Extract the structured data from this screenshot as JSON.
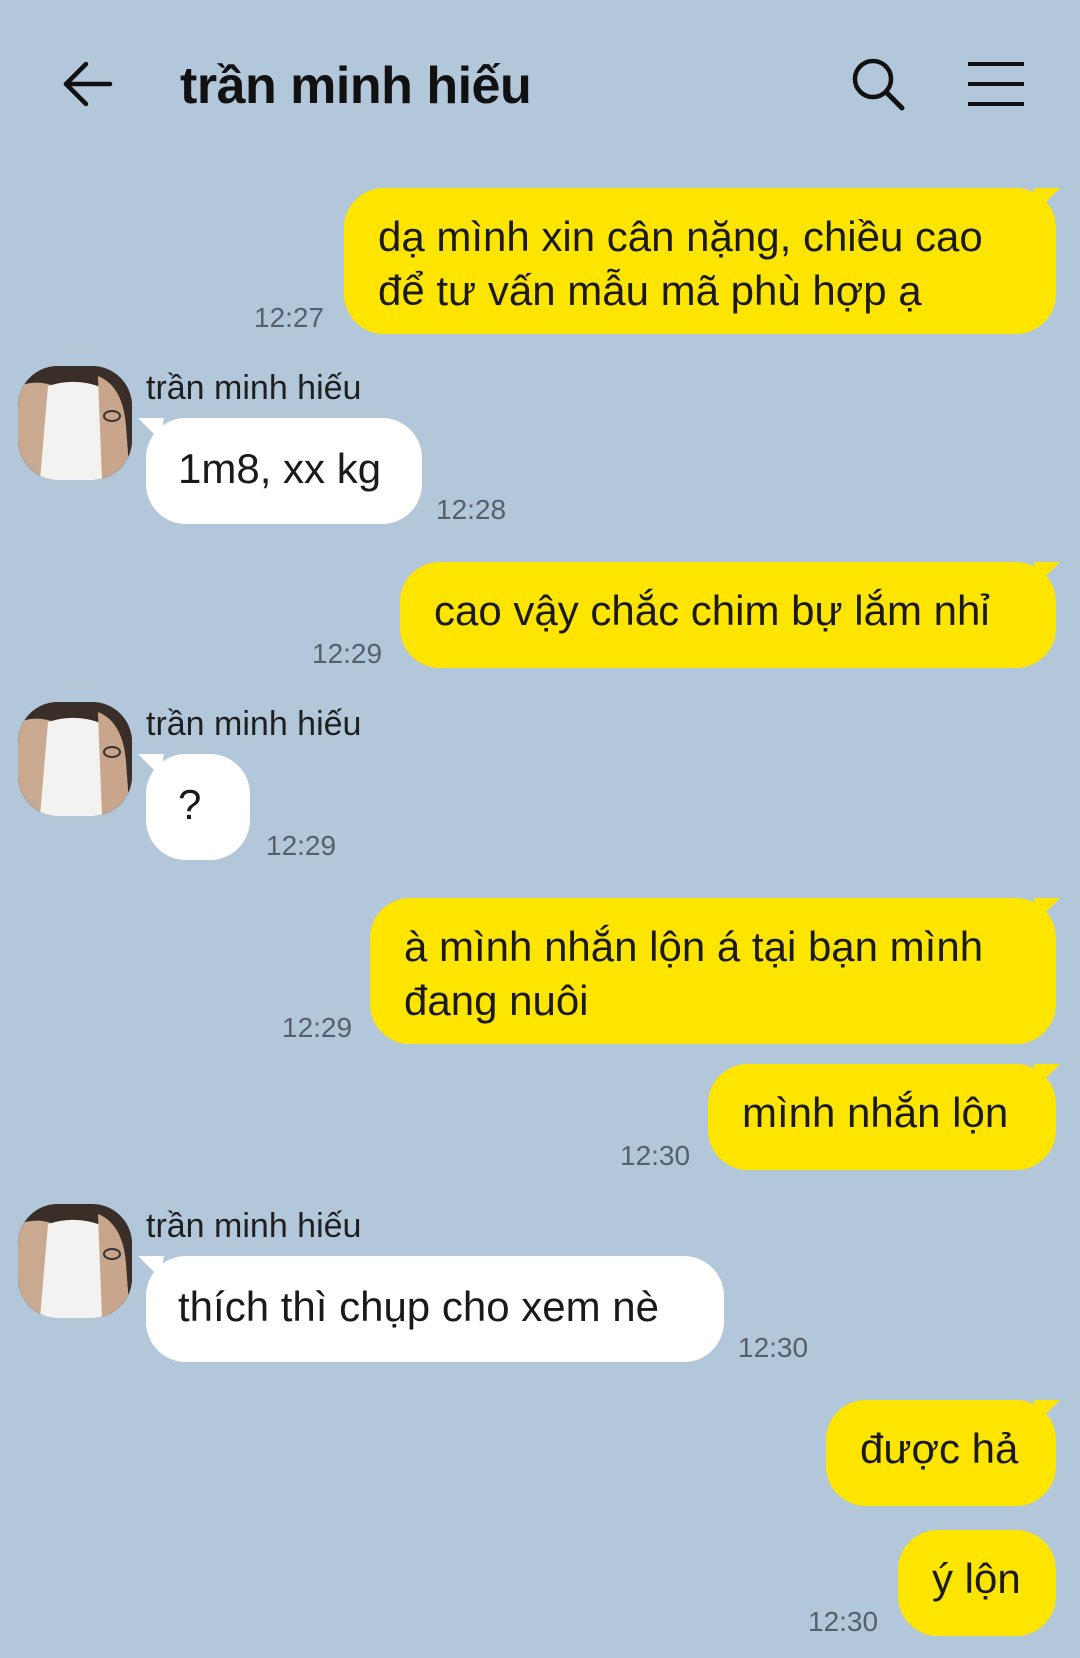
{
  "header": {
    "title": "trần minh hiếu",
    "back_icon": "arrow-left-icon",
    "search_icon": "search-icon",
    "menu_icon": "hamburger-menu-icon"
  },
  "colors": {
    "background": "#b2c7da",
    "my_bubble": "#fee500",
    "their_bubble": "#ffffff"
  },
  "messages": [
    {
      "side": "me",
      "lines": [
        "dạ mình xin cân nặng, chiều cao",
        "để tư vấn mẫu mã phù hợp ạ"
      ],
      "time": "12:27"
    },
    {
      "side": "them",
      "sender": "trần minh hiếu",
      "lines": [
        "1m8, xx kg"
      ],
      "time": "12:28"
    },
    {
      "side": "me",
      "lines": [
        "cao vậy chắc chim bự lắm nhỉ"
      ],
      "time": "12:29"
    },
    {
      "side": "them",
      "sender": "trần minh hiếu",
      "lines": [
        "?"
      ],
      "time": "12:29"
    },
    {
      "side": "me",
      "lines": [
        "à mình nhắn lộn á tại bạn mình",
        "đang nuôi"
      ],
      "time": "12:29"
    },
    {
      "side": "me",
      "lines": [
        "mình nhắn lộn"
      ],
      "time": "12:30"
    },
    {
      "side": "them",
      "sender": "trần minh hiếu",
      "lines": [
        "thích thì chụp cho xem nè"
      ],
      "time": "12:30"
    },
    {
      "side": "me",
      "lines": [
        "được hả"
      ],
      "time": ""
    },
    {
      "side": "me",
      "lines": [
        "ý lộn"
      ],
      "time": "12:30"
    }
  ]
}
